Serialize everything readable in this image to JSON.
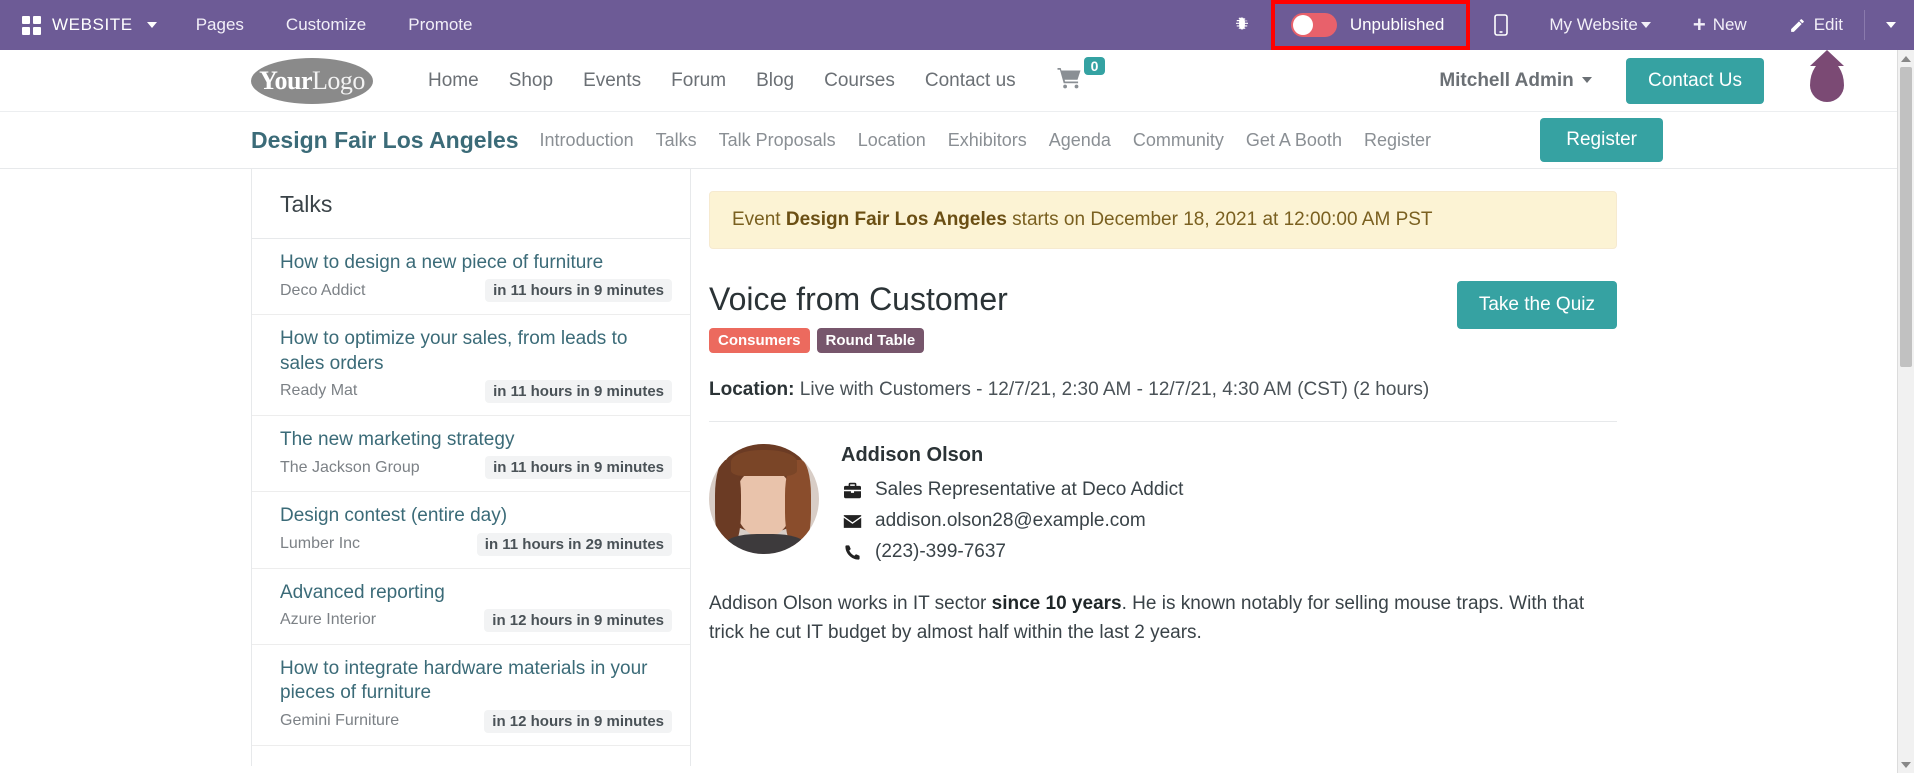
{
  "adminbar": {
    "apps_icon": "grid-icon",
    "brand": "WEBSITE",
    "items": [
      {
        "label": "Pages",
        "name": "pages"
      },
      {
        "label": "Customize",
        "name": "customize"
      },
      {
        "label": "Promote",
        "name": "promote"
      }
    ],
    "bug_icon": "bug-icon",
    "publish_toggle": {
      "label": "Unpublished",
      "state": "off",
      "highlight_color": "#ff0000"
    },
    "mobile_icon": "mobile-preview-icon",
    "my_website": "My Website",
    "new_label": "New",
    "edit_label": "Edit"
  },
  "site_header": {
    "logo": {
      "bold": "Your",
      "light": "Logo"
    },
    "nav": [
      {
        "label": "Home"
      },
      {
        "label": "Shop"
      },
      {
        "label": "Events"
      },
      {
        "label": "Forum"
      },
      {
        "label": "Blog"
      },
      {
        "label": "Courses"
      },
      {
        "label": "Contact us"
      }
    ],
    "cart_count": "0",
    "user": "Mitchell Admin",
    "contact_button": "Contact Us"
  },
  "event_nav": {
    "title": "Design Fair Los Angeles",
    "links": [
      {
        "label": "Introduction"
      },
      {
        "label": "Talks"
      },
      {
        "label": "Talk Proposals"
      },
      {
        "label": "Location"
      },
      {
        "label": "Exhibitors"
      },
      {
        "label": "Agenda"
      },
      {
        "label": "Community"
      },
      {
        "label": "Get A Booth"
      },
      {
        "label": "Register"
      }
    ],
    "register_button": "Register"
  },
  "sidebar": {
    "heading": "Talks",
    "talks": [
      {
        "title": "How to design a new piece of furniture",
        "org": "Deco Addict",
        "when": "in 11 hours in 9 minutes"
      },
      {
        "title": "How to optimize your sales, from leads to sales orders",
        "org": "Ready Mat",
        "when": "in 11 hours in 9 minutes"
      },
      {
        "title": "The new marketing strategy",
        "org": "The Jackson Group",
        "when": "in 11 hours in 9 minutes"
      },
      {
        "title": "Design contest (entire day)",
        "org": "Lumber Inc",
        "when": "in 11 hours in 29 minutes"
      },
      {
        "title": "Advanced reporting",
        "org": "Azure Interior",
        "when": "in 12 hours in 9 minutes"
      },
      {
        "title": "How to integrate hardware materials in your pieces of furniture",
        "org": "Gemini Furniture",
        "when": "in 12 hours in 9 minutes"
      }
    ]
  },
  "main": {
    "alert": {
      "prefix": "Event ",
      "event_name": "Design Fair Los Angeles",
      "suffix": " starts on December 18, 2021 at 12:00:00 AM PST"
    },
    "talk_title": "Voice from Customer",
    "badges": [
      {
        "label": "Consumers",
        "color": "#ec6a5e"
      },
      {
        "label": "Round Table",
        "color": "#77566c"
      }
    ],
    "quiz_button": "Take the Quiz",
    "location_label": "Location:",
    "location_value": " Live with Customers - 12/7/21, 2:30 AM - 12/7/21, 4:30 AM (CST) (2 hours)",
    "speaker": {
      "name": "Addison Olson",
      "role_icon": "briefcase-icon",
      "role": "Sales Representative at Deco Addict",
      "email_icon": "envelope-icon",
      "email": "addison.olson28@example.com",
      "phone_icon": "phone-icon",
      "phone": "(223)-399-7637"
    },
    "bio": {
      "part1": "Addison Olson works in IT sector ",
      "bold": "since 10 years",
      "part2": ". He is known notably for selling mouse traps. With that trick he cut IT budget by almost half within the last 2 years."
    }
  }
}
